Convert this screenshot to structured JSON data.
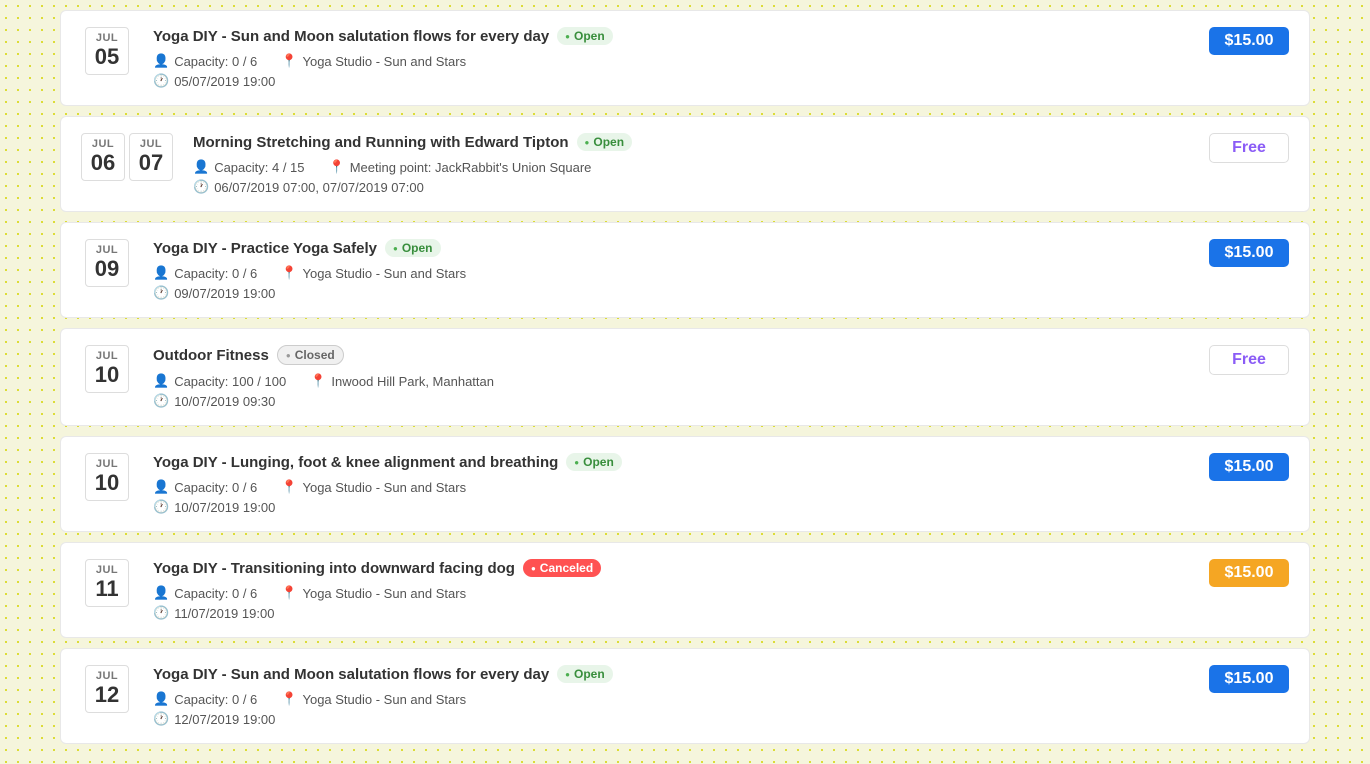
{
  "events": [
    {
      "id": 1,
      "month": "JUL",
      "day": "05",
      "title": "Yoga DIY - Sun and Moon salutation flows for every day",
      "status": "open",
      "status_label": "Open",
      "capacity": "Capacity: 0 / 6",
      "location": "Yoga Studio - Sun and Stars",
      "datetime": "05/07/2019 19:00",
      "price_type": "paid-blue",
      "price": "$15.00",
      "two_dates": false
    },
    {
      "id": 2,
      "month": "JUL",
      "day": "06",
      "month2": "JUL",
      "day2": "07",
      "title": "Morning Stretching and Running with Edward Tipton",
      "status": "open",
      "status_label": "Open",
      "capacity": "Capacity: 4 / 15",
      "location": "Meeting point: JackRabbit's Union Square",
      "datetime": "06/07/2019 07:00, 07/07/2019 07:00",
      "price_type": "free",
      "price": "Free",
      "two_dates": true
    },
    {
      "id": 3,
      "month": "JUL",
      "day": "09",
      "title": "Yoga DIY - Practice Yoga Safely",
      "status": "open",
      "status_label": "Open",
      "capacity": "Capacity: 0 / 6",
      "location": "Yoga Studio - Sun and Stars",
      "datetime": "09/07/2019 19:00",
      "price_type": "paid-blue",
      "price": "$15.00",
      "two_dates": false
    },
    {
      "id": 4,
      "month": "JUL",
      "day": "10",
      "title": "Outdoor Fitness",
      "status": "closed",
      "status_label": "Closed",
      "capacity": "Capacity: 100 / 100",
      "location": "Inwood Hill Park, Manhattan",
      "datetime": "10/07/2019 09:30",
      "price_type": "free",
      "price": "Free",
      "two_dates": false
    },
    {
      "id": 5,
      "month": "JUL",
      "day": "10",
      "title": "Yoga DIY - Lunging, foot & knee alignment and breathing",
      "status": "open",
      "status_label": "Open",
      "capacity": "Capacity: 0 / 6",
      "location": "Yoga Studio - Sun and Stars",
      "datetime": "10/07/2019 19:00",
      "price_type": "paid-blue",
      "price": "$15.00",
      "two_dates": false
    },
    {
      "id": 6,
      "month": "JUL",
      "day": "11",
      "title": "Yoga DIY - Transitioning into downward facing dog",
      "status": "canceled",
      "status_label": "Canceled",
      "capacity": "Capacity: 0 / 6",
      "location": "Yoga Studio - Sun and Stars",
      "datetime": "11/07/2019 19:00",
      "price_type": "paid-orange",
      "price": "$15.00",
      "two_dates": false
    },
    {
      "id": 7,
      "month": "JUL",
      "day": "12",
      "title": "Yoga DIY - Sun and Moon salutation flows for every day",
      "status": "open",
      "status_label": "Open",
      "capacity": "Capacity: 0 / 6",
      "location": "Yoga Studio - Sun and Stars",
      "datetime": "12/07/2019 19:00",
      "price_type": "paid-blue",
      "price": "$15.00",
      "two_dates": false
    }
  ]
}
